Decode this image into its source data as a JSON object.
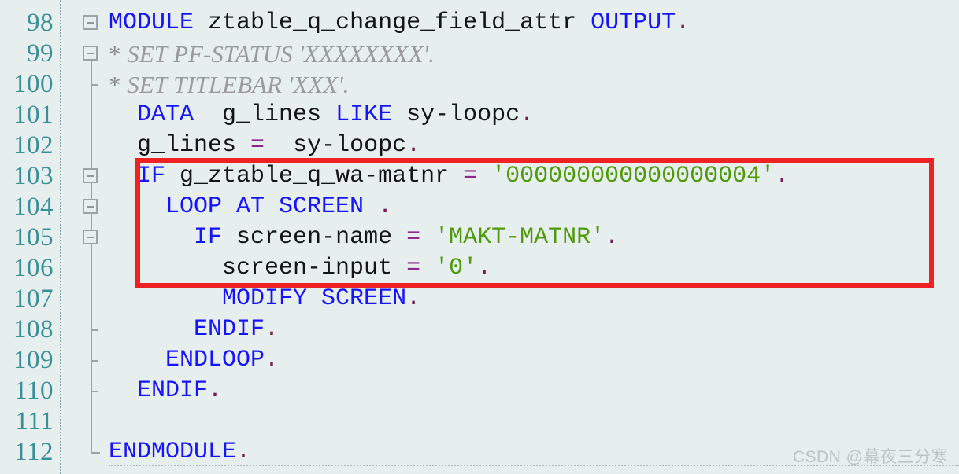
{
  "editor": {
    "language": "ABAP",
    "background_color": "#e7eeee",
    "line_number_color": "#3a9099",
    "keyword_color": "#1414ff",
    "string_color": "#4f9a0b",
    "operator_color": "#8e2a8e",
    "comment_color": "#9b9b9b",
    "annotation_color": "#ee2222",
    "first_visible_line": 98,
    "last_visible_line": 112,
    "clipped_top_line_number": "97"
  },
  "gutter": {
    "line_numbers": [
      "98",
      "99",
      "100",
      "101",
      "102",
      "103",
      "104",
      "105",
      "106",
      "107",
      "108",
      "109",
      "110",
      "111",
      "112"
    ]
  },
  "fold_markers": [
    {
      "line": "98",
      "type": "collapse-box"
    },
    {
      "line": "99",
      "type": "collapse-box"
    },
    {
      "line": "100",
      "type": "tick"
    },
    {
      "line": "103",
      "type": "collapse-box"
    },
    {
      "line": "104",
      "type": "collapse-box"
    },
    {
      "line": "105",
      "type": "collapse-box"
    },
    {
      "line": "108",
      "type": "tick"
    },
    {
      "line": "109",
      "type": "tick"
    },
    {
      "line": "110",
      "type": "tick"
    },
    {
      "line": "112",
      "type": "end-bracket"
    }
  ],
  "code_lines": [
    {
      "number": "98",
      "plain": "MODULE ztable_q_change_field_attr OUTPUT.",
      "tokens": [
        {
          "t": "",
          "c": "ind"
        },
        {
          "t": "MODULE",
          "c": "kw"
        },
        {
          "t": " ztable_q_change_field_attr ",
          "c": "id"
        },
        {
          "t": "OUTPUT",
          "c": "kw"
        },
        {
          "t": ".",
          "c": "dot"
        }
      ]
    },
    {
      "number": "99",
      "plain": "* SET PF-STATUS 'XXXXXXXX'.",
      "tokens": [
        {
          "t": "",
          "c": "ind"
        },
        {
          "t": "* ",
          "c": "star"
        },
        {
          "t": "SET PF-STATUS 'XXXXXXXX'.",
          "c": "cmt"
        }
      ]
    },
    {
      "number": "100",
      "plain": "* SET TITLEBAR 'XXX'.",
      "tokens": [
        {
          "t": "",
          "c": "ind"
        },
        {
          "t": "* ",
          "c": "star"
        },
        {
          "t": "SET TITLEBAR 'XXX'.",
          "c": "cmt"
        }
      ]
    },
    {
      "number": "101",
      "plain": "  DATA  g_lines LIKE sy-loopc.",
      "tokens": [
        {
          "t": "  ",
          "c": "ind"
        },
        {
          "t": "DATA",
          "c": "kw"
        },
        {
          "t": "  g_lines ",
          "c": "id"
        },
        {
          "t": "LIKE",
          "c": "kw"
        },
        {
          "t": " sy-loopc",
          "c": "id"
        },
        {
          "t": ".",
          "c": "dot"
        }
      ]
    },
    {
      "number": "102",
      "plain": "  g_lines =  sy-loopc.",
      "tokens": [
        {
          "t": "  ",
          "c": "ind"
        },
        {
          "t": "g_lines ",
          "c": "id"
        },
        {
          "t": "=",
          "c": "op"
        },
        {
          "t": "  sy-loopc",
          "c": "id"
        },
        {
          "t": ".",
          "c": "dot"
        }
      ]
    },
    {
      "number": "103",
      "plain": "  IF g_ztable_q_wa-matnr = '000000000000000004'.",
      "tokens": [
        {
          "t": "  ",
          "c": "ind"
        },
        {
          "t": "IF",
          "c": "kw"
        },
        {
          "t": " g_ztable_q_wa-matnr ",
          "c": "id"
        },
        {
          "t": "=",
          "c": "op"
        },
        {
          "t": " ",
          "c": "id"
        },
        {
          "t": "'000000000000000004'",
          "c": "str"
        },
        {
          "t": ".",
          "c": "dot"
        }
      ]
    },
    {
      "number": "104",
      "plain": "    LOOP AT SCREEN .",
      "tokens": [
        {
          "t": "    ",
          "c": "ind"
        },
        {
          "t": "LOOP AT SCREEN",
          "c": "kw"
        },
        {
          "t": " ",
          "c": "id"
        },
        {
          "t": ".",
          "c": "dot"
        }
      ]
    },
    {
      "number": "105",
      "plain": "      IF screen-name = 'MAKT-MATNR'.",
      "tokens": [
        {
          "t": "      ",
          "c": "ind"
        },
        {
          "t": "IF",
          "c": "kw"
        },
        {
          "t": " screen-name ",
          "c": "id"
        },
        {
          "t": "=",
          "c": "op"
        },
        {
          "t": " ",
          "c": "id"
        },
        {
          "t": "'MAKT-MATNR'",
          "c": "str"
        },
        {
          "t": ".",
          "c": "dot"
        }
      ]
    },
    {
      "number": "106",
      "plain": "        screen-input = '0'.",
      "tokens": [
        {
          "t": "        ",
          "c": "ind"
        },
        {
          "t": "screen-input ",
          "c": "id"
        },
        {
          "t": "=",
          "c": "op"
        },
        {
          "t": " ",
          "c": "id"
        },
        {
          "t": "'0'",
          "c": "str"
        },
        {
          "t": ".",
          "c": "dot"
        }
      ]
    },
    {
      "number": "107",
      "plain": "        MODIFY SCREEN.",
      "tokens": [
        {
          "t": "        ",
          "c": "ind"
        },
        {
          "t": "MODIFY SCREEN",
          "c": "kw"
        },
        {
          "t": ".",
          "c": "dot"
        }
      ]
    },
    {
      "number": "108",
      "plain": "      ENDIF.",
      "tokens": [
        {
          "t": "      ",
          "c": "ind"
        },
        {
          "t": "ENDIF",
          "c": "kw"
        },
        {
          "t": ".",
          "c": "dot"
        }
      ]
    },
    {
      "number": "109",
      "plain": "    ENDLOOP.",
      "tokens": [
        {
          "t": "    ",
          "c": "ind"
        },
        {
          "t": "ENDLOOP",
          "c": "kw"
        },
        {
          "t": ".",
          "c": "dot"
        }
      ]
    },
    {
      "number": "110",
      "plain": "  ENDIF.",
      "tokens": [
        {
          "t": "  ",
          "c": "ind"
        },
        {
          "t": "ENDIF",
          "c": "kw"
        },
        {
          "t": ".",
          "c": "dot"
        }
      ]
    },
    {
      "number": "111",
      "plain": "",
      "tokens": []
    },
    {
      "number": "112",
      "plain": "ENDMODULE.",
      "tokens": [
        {
          "t": "",
          "c": "ind"
        },
        {
          "t": "ENDMODULE",
          "c": "kw"
        },
        {
          "t": ".",
          "c": "dot"
        }
      ]
    }
  ],
  "annotation": {
    "type": "red-rectangle-highlight",
    "covers_lines": [
      "103",
      "104",
      "105",
      "106"
    ],
    "color": "#ee2222"
  },
  "watermark": {
    "text": "CSDN @幕夜三分寒"
  }
}
